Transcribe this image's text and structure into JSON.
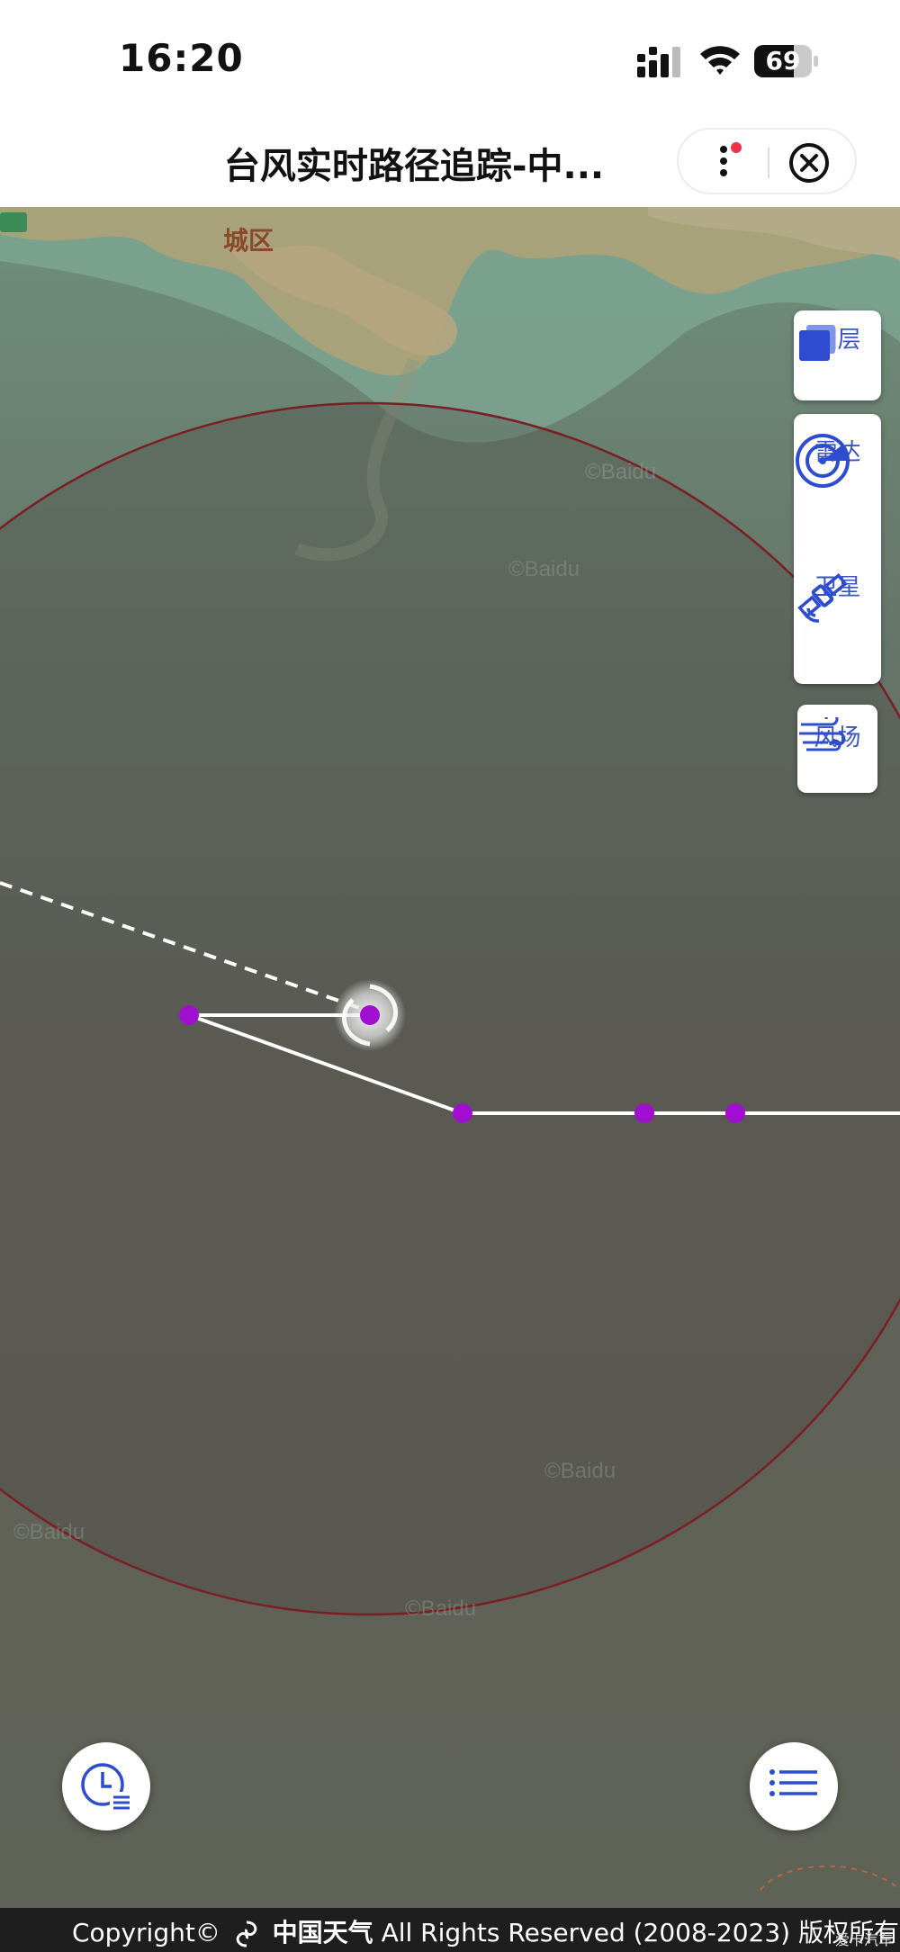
{
  "status_bar": {
    "time": "16:20",
    "battery": "69",
    "battery_level": 0.69
  },
  "header": {
    "title": "台风实时路径追踪-中..."
  },
  "map": {
    "labels": {
      "district": "城区"
    },
    "tools": [
      {
        "label": "图层",
        "icon": "layers-icon"
      },
      {
        "label": "雷达",
        "icon": "radar-icon"
      },
      {
        "label": "卫星",
        "icon": "satellite-icon"
      },
      {
        "label": "风场",
        "icon": "wind-field-icon"
      }
    ],
    "colors": {
      "track_point": "#a00fd0",
      "wind_circle": "#7a1f24",
      "tool_blue": "#2d4ccf"
    }
  },
  "bottom_controls": {
    "history_icon": "clock-list-icon",
    "list_icon": "list-icon"
  },
  "footer": {
    "copyright_prefix": "Copyright©",
    "brand": "中国天气",
    "rights": "All Rights Reserved (2008-2023) 版权所有",
    "watermark": "爱卡汽车"
  }
}
